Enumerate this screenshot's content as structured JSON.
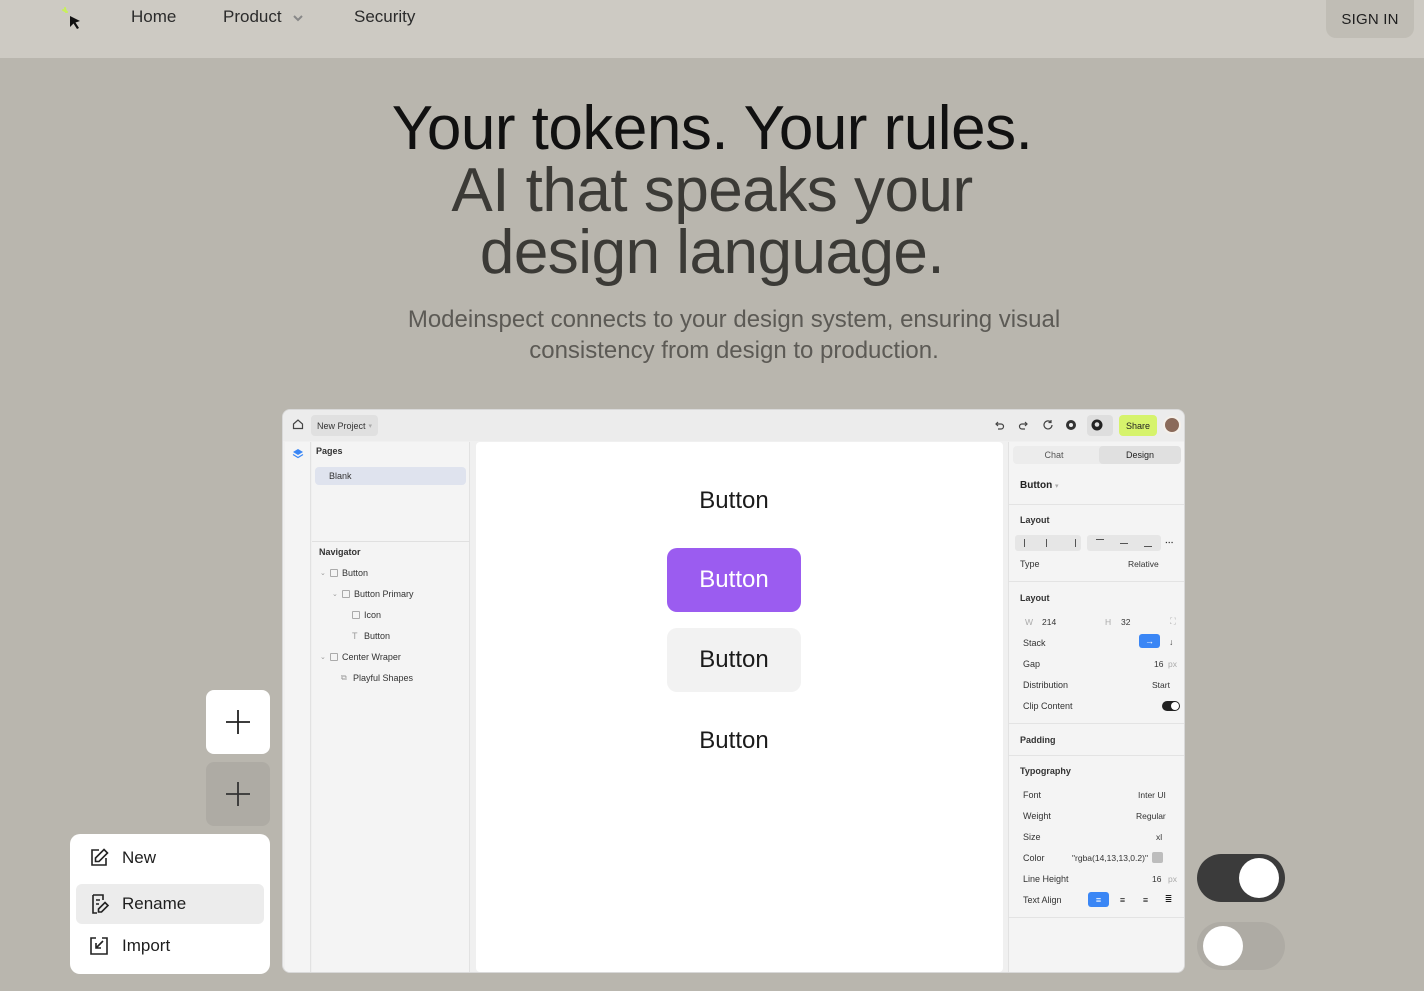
{
  "nav": {
    "home": "Home",
    "product": "Product",
    "security": "Security",
    "sign_in": "SIGN IN"
  },
  "hero": {
    "line1": "Your tokens. Your rules.",
    "line2": "AI that speaks your",
    "line3": "design language.",
    "subtitle": "Modeinspect connects to your design system, ensuring visual consistency from design to production."
  },
  "app": {
    "project_name": "New Project",
    "share_label": "Share",
    "left_panel": {
      "pages_title": "Pages",
      "pages": [
        "Blank"
      ],
      "navigator_title": "Navigator",
      "tree": [
        {
          "label": "Button",
          "icon": "frame-icon"
        },
        {
          "label": "Button Primary",
          "icon": "frame-icon"
        },
        {
          "label": "Icon",
          "icon": "frame-icon"
        },
        {
          "label": "Button",
          "icon": "text-icon"
        },
        {
          "label": "Center Wraper",
          "icon": "frame-icon"
        },
        {
          "label": "Playful Shapes",
          "icon": "shapes-icon"
        }
      ]
    },
    "canvas": {
      "button_text": "Button",
      "button_primary": "Button",
      "button_secondary": "Button",
      "button_ghost": "Button",
      "primary_color": "#9b5cf0"
    },
    "right_panel": {
      "tab_chat": "Chat",
      "tab_design": "Design",
      "selected": "Button",
      "layout_title": "Layout",
      "type_label": "Type",
      "type_value": "Relative",
      "layout2_title": "Layout",
      "w_label": "W",
      "w_value": "214",
      "h_label": "H",
      "h_value": "32",
      "stack_label": "Stack",
      "gap_label": "Gap",
      "gap_value": "16",
      "gap_unit": "px",
      "distribution_label": "Distribution",
      "distribution_value": "Start",
      "clip_label": "Clip Content",
      "padding_title": "Padding",
      "typography_title": "Typography",
      "font_label": "Font",
      "font_value": "Inter UI",
      "weight_label": "Weight",
      "weight_value": "Regular",
      "size_label": "Size",
      "size_value": "xl",
      "color_label": "Color",
      "color_value": "\"rgba(14,13,13,0.2)\"",
      "lh_label": "Line Height",
      "lh_value": "16",
      "lh_unit": "px",
      "ta_label": "Text Align",
      "accent": "#3a86f5"
    }
  },
  "menu": {
    "new": "New",
    "rename": "Rename",
    "import": "Import"
  },
  "toggles": {
    "top_on": true,
    "bottom_on": false
  }
}
